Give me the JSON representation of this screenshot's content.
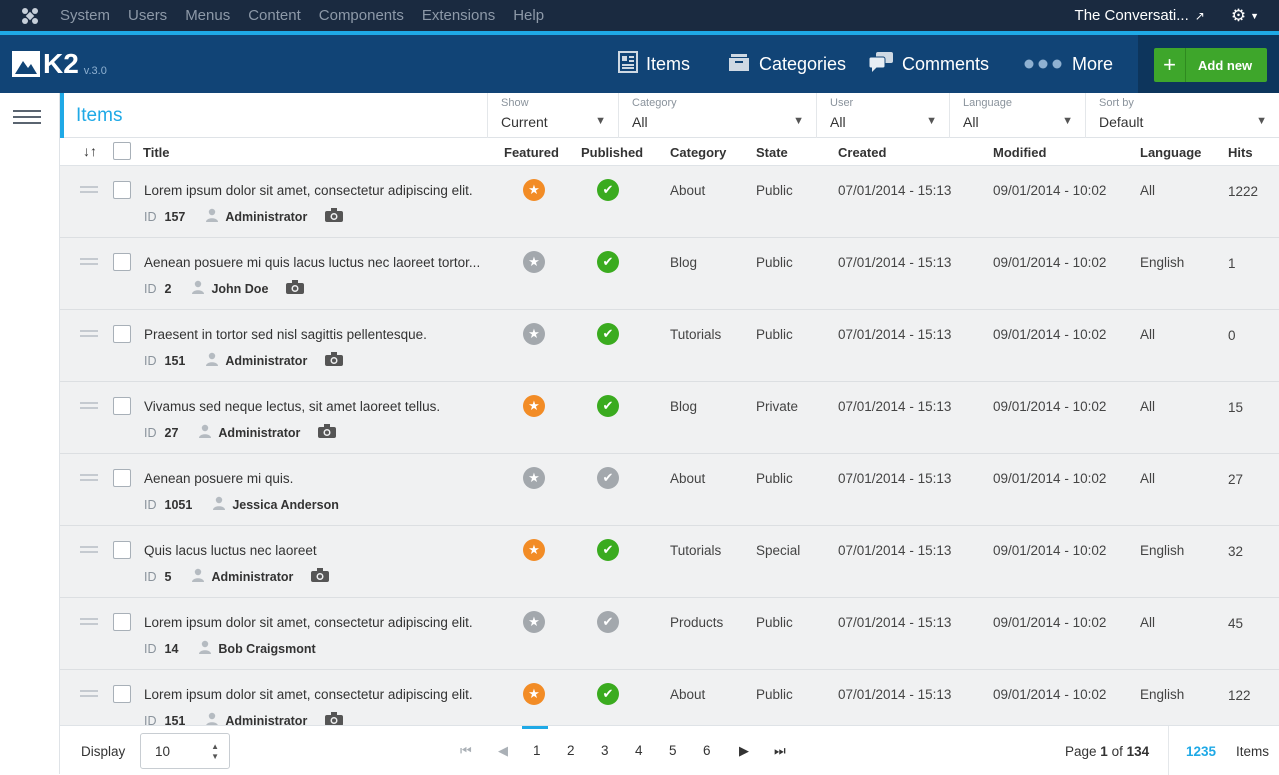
{
  "sysbar": {
    "menu": [
      "System",
      "Users",
      "Menus",
      "Content",
      "Components",
      "Extensions",
      "Help"
    ],
    "site_name": "The Conversati...",
    "ext_icon": "external-link-icon",
    "gear_icon": "gear-icon"
  },
  "k2": {
    "brand": "K2",
    "version": "v.3.0",
    "nav": {
      "items": "Items",
      "categories": "Categories",
      "comments": "Comments",
      "more": "More"
    },
    "add_new": "Add new"
  },
  "filters": {
    "title": "Items",
    "show": {
      "label": "Show",
      "value": "Current"
    },
    "category": {
      "label": "Category",
      "value": "All"
    },
    "user": {
      "label": "User",
      "value": "All"
    },
    "language": {
      "label": "Language",
      "value": "All"
    },
    "sort": {
      "label": "Sort by",
      "value": "Default"
    }
  },
  "columns": {
    "title": "Title",
    "featured": "Featured",
    "published": "Published",
    "category": "Category",
    "state": "State",
    "created": "Created",
    "modified": "Modified",
    "language": "Language",
    "hits": "Hits"
  },
  "id_label": "ID",
  "rows": [
    {
      "title": "Lorem ipsum dolor sit amet, consectetur adipiscing elit.",
      "id": "157",
      "author": "Administrator",
      "has_image": true,
      "featured": true,
      "published": true,
      "category": "About",
      "state": "Public",
      "created": "07/01/2014 - 15:13",
      "modified": "09/01/2014 - 10:02",
      "language": "All",
      "hits": "1222"
    },
    {
      "title": "Aenean posuere mi quis lacus luctus nec laoreet tortor...",
      "id": "2",
      "author": "John Doe",
      "has_image": true,
      "featured": false,
      "published": true,
      "category": "Blog",
      "state": "Public",
      "created": "07/01/2014 - 15:13",
      "modified": "09/01/2014 - 10:02",
      "language": "English",
      "hits": "1"
    },
    {
      "title": "Praesent in tortor sed nisl sagittis pellentesque.",
      "id": "151",
      "author": "Administrator",
      "has_image": true,
      "featured": false,
      "published": true,
      "category": "Tutorials",
      "state": "Public",
      "created": "07/01/2014 - 15:13",
      "modified": "09/01/2014 - 10:02",
      "language": "All",
      "hits": "0"
    },
    {
      "title": "Vivamus sed neque lectus, sit amet laoreet tellus.",
      "id": "27",
      "author": "Administrator",
      "has_image": true,
      "featured": true,
      "published": true,
      "category": "Blog",
      "state": "Private",
      "created": "07/01/2014 - 15:13",
      "modified": "09/01/2014 - 10:02",
      "language": "All",
      "hits": "15"
    },
    {
      "title": "Aenean posuere mi quis.",
      "id": "1051",
      "author": "Jessica Anderson",
      "has_image": false,
      "featured": false,
      "published": false,
      "category": "About",
      "state": "Public",
      "created": "07/01/2014 - 15:13",
      "modified": "09/01/2014 - 10:02",
      "language": "All",
      "hits": "27"
    },
    {
      "title": " Quis lacus luctus nec laoreet",
      "id": "5",
      "author": "Administrator",
      "has_image": true,
      "featured": true,
      "published": true,
      "category": "Tutorials",
      "state": "Special",
      "created": "07/01/2014 - 15:13",
      "modified": "09/01/2014 - 10:02",
      "language": "English",
      "hits": "32"
    },
    {
      "title": "Lorem ipsum dolor sit amet, consectetur adipiscing elit.",
      "id": "14",
      "author": "Bob Craigsmont",
      "has_image": false,
      "featured": false,
      "published": false,
      "category": "Products",
      "state": "Public",
      "created": "07/01/2014 - 15:13",
      "modified": "09/01/2014 - 10:02",
      "language": "All",
      "hits": "45"
    },
    {
      "title": "Lorem ipsum dolor sit amet, consectetur adipiscing elit.",
      "id": "151",
      "author": "Administrator",
      "has_image": true,
      "featured": true,
      "published": true,
      "category": "About",
      "state": "Public",
      "created": "07/01/2014 - 15:13",
      "modified": "09/01/2014 - 10:02",
      "language": "English",
      "hits": "122"
    }
  ],
  "footer": {
    "display_label": "Display",
    "display_value": "10",
    "pages": [
      "1",
      "2",
      "3",
      "4",
      "5",
      "6"
    ],
    "active_page": "1",
    "page_word": "Page",
    "current_page": "1",
    "of_word": "of",
    "total_pages": "134",
    "item_count": "1235",
    "items_word": "Items"
  },
  "colors": {
    "accent": "#1fa9e6",
    "header": "#114476",
    "sysbar": "#1a2a40",
    "featured": "#f28c26",
    "published": "#3aab1f",
    "inactive": "#a3a8ad",
    "add": "#3ea62b"
  }
}
